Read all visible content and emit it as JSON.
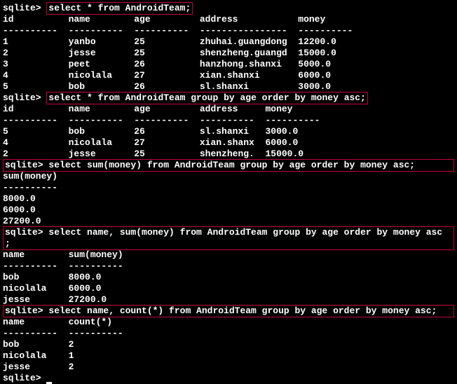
{
  "prompt": "sqlite>",
  "queries": {
    "q1": "select * from AndroidTeam;",
    "q2": "select * from AndroidTeam group by age order by money asc;",
    "q3": " select sum(money) from AndroidTeam group by age order by money asc;",
    "q4": " select name, sum(money) from AndroidTeam group by age order by money asc",
    "q4_cont": ";",
    "q5": " select name, count(*) from AndroidTeam group by age order by money asc;"
  },
  "headers": {
    "h1": "id          name        age         address           money",
    "h2": "id          name        age         address     money",
    "h3": "sum(money)",
    "h4": "name        sum(money)",
    "h5": "name        count(*)"
  },
  "separators": {
    "s1": "----------  ----------  ----------  ----------------  ----------",
    "s2": "----------  ----------  ----------  ----------  ----------",
    "s3": "----------",
    "s4": "----------  ----------",
    "s5": "----------  ----------"
  },
  "rows1": {
    "r1": "1           yanbo       25          zhuhai.guangdong  12200.0",
    "r2": "2           jesse       25          shenzheng.guangd  15000.0",
    "r3": "3           peet        26          hanzhong.shanxi   5000.0",
    "r4": "4           nicolala    27          xian.shanxi       6000.0",
    "r5": "5           bob         26          sl.shanxi         3000.0"
  },
  "rows2": {
    "r1": "5           bob         26          sl.shanxi   3000.0",
    "r2": "4           nicolala    27          xian.shanx  6000.0",
    "r3": "2           jesse       25          shenzheng.  15000.0"
  },
  "rows3": {
    "r1": "8000.0",
    "r2": "6000.0",
    "r3": "27200.0"
  },
  "rows4": {
    "r1": "bob         8000.0",
    "r2": "nicolala    6000.0",
    "r3": "jesse       27200.0"
  },
  "rows5": {
    "r1": "bob         2",
    "r2": "nicolala    1",
    "r3": "jesse       2"
  }
}
